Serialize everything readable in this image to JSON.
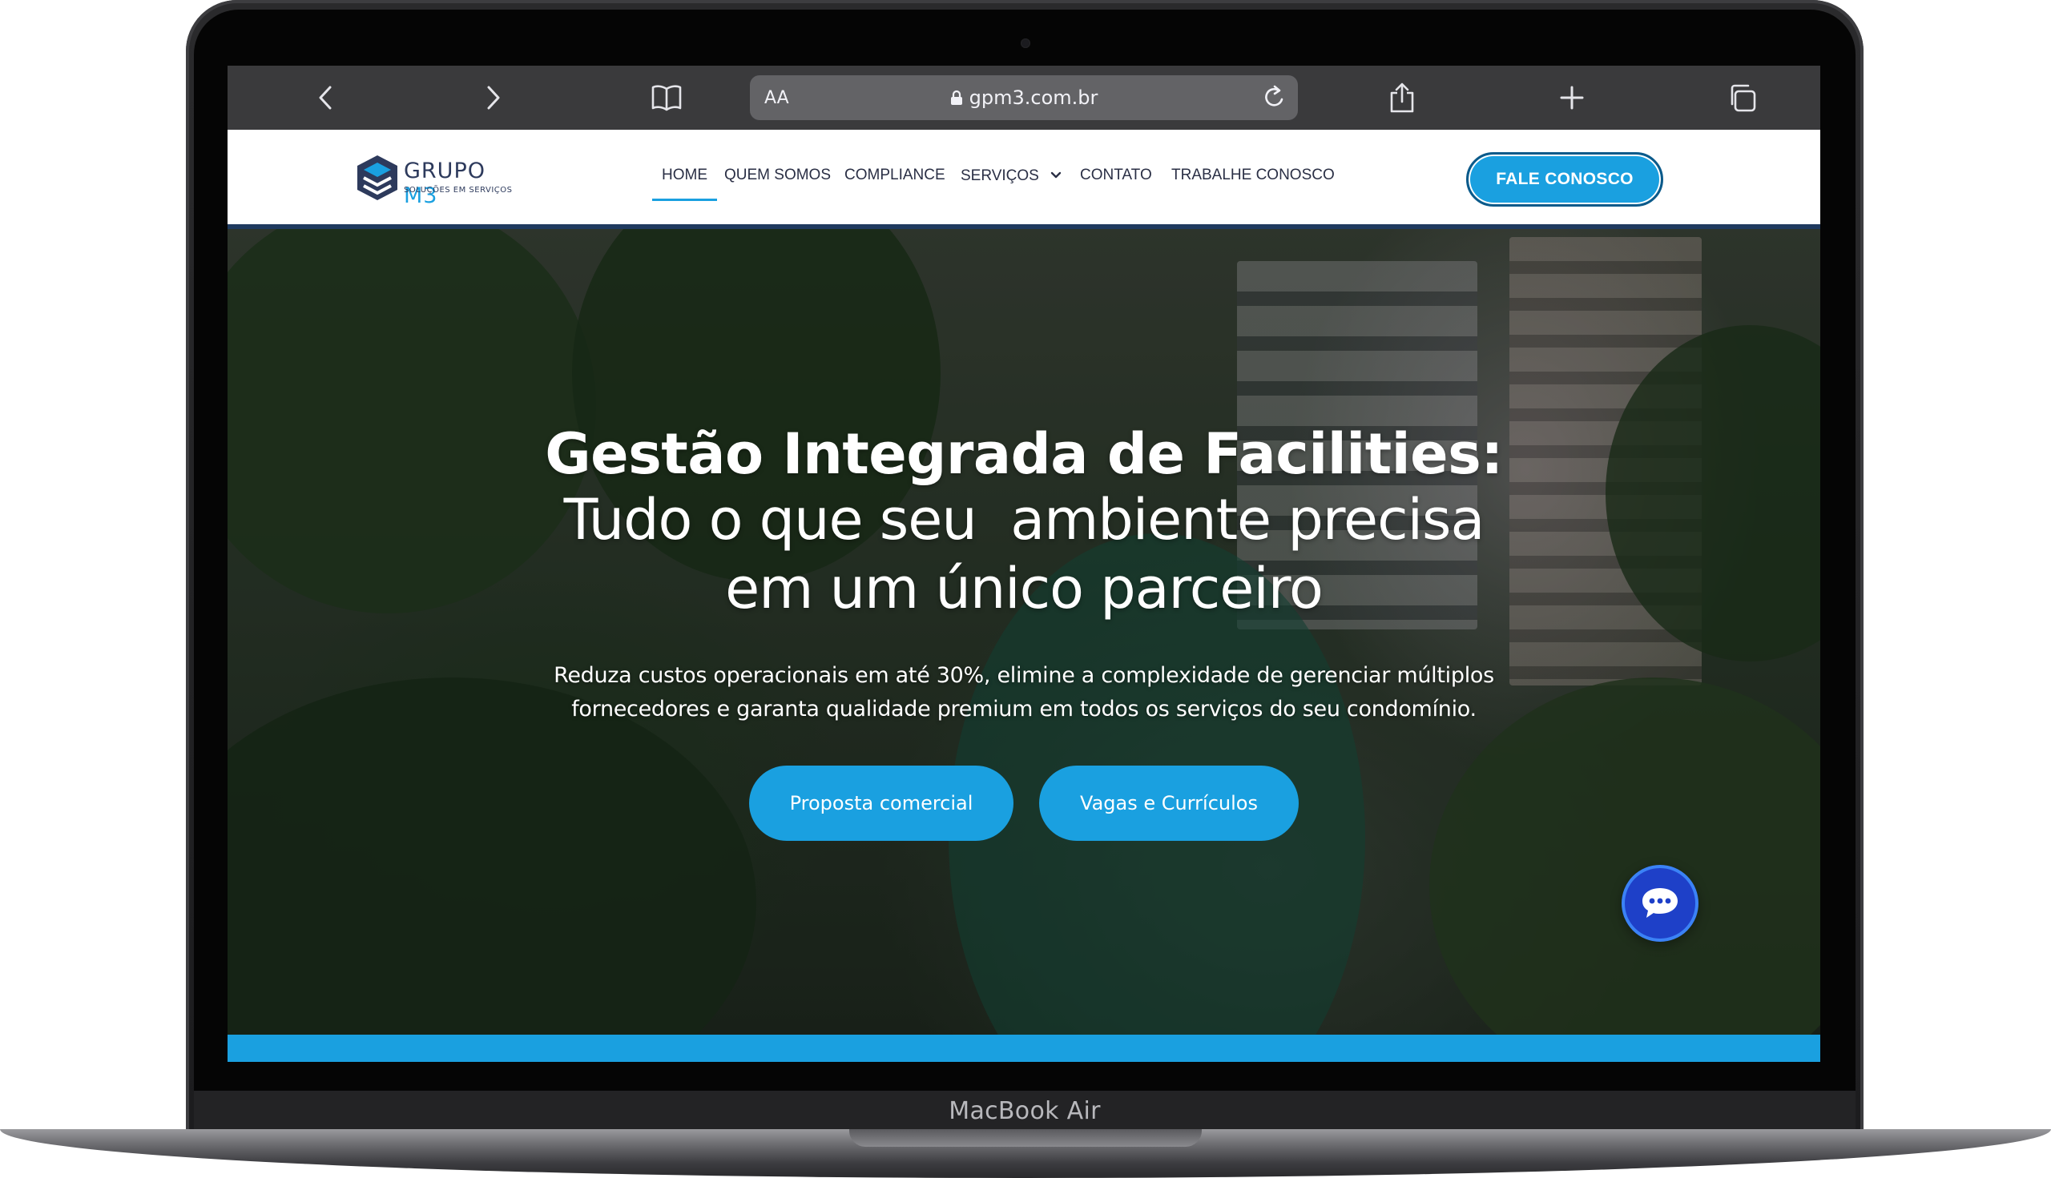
{
  "device": {
    "label": "MacBook Air"
  },
  "browser": {
    "aa_label": "AA",
    "url": "gpm3.com.br"
  },
  "header": {
    "logo": {
      "name": "GRUPO",
      "name_accent": "M3",
      "tagline": "SOLUÇÕES EM SERVIÇOS"
    },
    "nav": [
      {
        "label": "HOME",
        "active": true
      },
      {
        "label": "QUEM SOMOS"
      },
      {
        "label": "COMPLIANCE"
      },
      {
        "label": "SERVIÇOS",
        "has_dropdown": true
      },
      {
        "label": "CONTATO"
      },
      {
        "label": "TRABALHE CONOSCO"
      }
    ],
    "cta_label": "FALE CONOSCO"
  },
  "hero": {
    "title_line1": "Gestão Integrada de Facilities:",
    "title_line2": "Tudo o que seu  ambiente precisa",
    "title_line3": "em um único parceiro",
    "subtitle_line1": "Reduza custos operacionais em até 30%, elimine a complexidade de gerenciar múltiplos",
    "subtitle_line2": "fornecedores e garanta qualidade premium em todos os serviços do seu condomínio.",
    "button_primary": "Proposta comercial",
    "button_secondary": "Vagas e Currículos"
  },
  "colors": {
    "accent": "#1aa0e0",
    "navy": "#1f3a5f",
    "browser_bar": "#3a3a3c",
    "chat": "#1e40c8"
  },
  "icons": {
    "back": "chevron-left-icon",
    "forward": "chevron-right-icon",
    "bookmarks": "book-icon",
    "lock": "lock-icon",
    "reload": "reload-icon",
    "share": "share-icon",
    "new_tab": "plus-icon",
    "tabs": "tabs-icon",
    "chat": "chat-bubble-icon"
  }
}
